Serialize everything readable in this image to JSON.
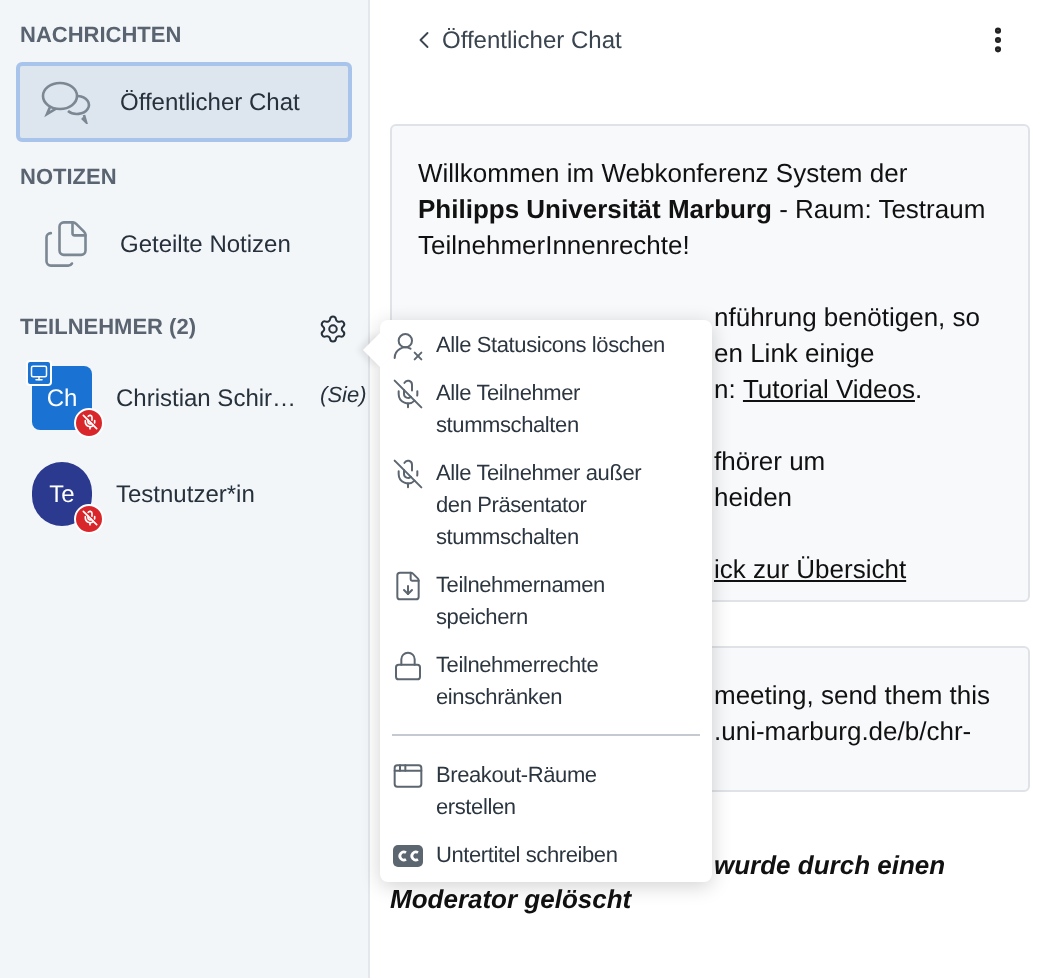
{
  "sidebar": {
    "sections": [
      {
        "title": "NACHRICHTEN",
        "items": [
          {
            "label": "Öffentlicher Chat",
            "selected": true
          }
        ]
      },
      {
        "title": "NOTIZEN",
        "items": [
          {
            "label": "Geteilte Notizen",
            "selected": false
          }
        ]
      }
    ],
    "participants": {
      "title": "TEILNEHMER (2)",
      "users": [
        {
          "initials": "Ch",
          "name": "Christian Schir…",
          "you": "(Sie)",
          "color": "#1a73d3",
          "presenter": true,
          "muted": true
        },
        {
          "initials": "Te",
          "name": "Testnutzer*in",
          "color": "#2b3a8f",
          "presenter": false,
          "muted": true
        }
      ]
    }
  },
  "chat": {
    "title": "Öffentlicher Chat",
    "cards": [
      {
        "paragraphs": [
          {
            "lines": [
              {
                "segments": [
                  {
                    "text": "Willkommen im Webkonferenz System der",
                    "link": false
                  }
                ]
              },
              {
                "segments": [
                  {
                    "text": "**Philipps Universität Marburg** - Raum: Testraum",
                    "link": false
                  }
                ]
              },
              {
                "segments": [
                  {
                    "text": "TeilnehmerInnenrechte!",
                    "link": false
                  }
                ]
              }
            ]
          },
          {
            "lines": [
              {
                "segments": [
                  {
                    "text": "nführung benötigen, so",
                    "link": false
                  }
                ]
              },
              {
                "segments": [
                  {
                    "text": "en Link einige",
                    "link": false
                  }
                ]
              },
              {
                "segments": [
                  {
                    "text": "n: ",
                    "link": false
                  },
                  {
                    "text": "Tutorial Videos",
                    "link": true
                  },
                  {
                    "text": ".",
                    "link": false
                  }
                ]
              }
            ]
          },
          {
            "lines": [
              {
                "segments": [
                  {
                    "text": "fhörer um",
                    "link": false
                  }
                ]
              },
              {
                "segments": [
                  {
                    "text": "heiden",
                    "link": false
                  }
                ]
              }
            ]
          },
          {
            "lines": [
              {
                "segments": [
                  {
                    "text": "ick zur Übersicht",
                    "link": true
                  }
                ]
              }
            ]
          }
        ]
      },
      {
        "paragraphs": [
          {
            "lines": [
              {
                "segments": [
                  {
                    "text": "meeting, send them this",
                    "link": false
                  }
                ]
              },
              {
                "segments": [
                  {
                    "text": ".uni-marburg.de/b/chr-",
                    "link": false
                  }
                ]
              }
            ]
          }
        ]
      }
    ],
    "system_message": {
      "lines": [
        {
          "text": "wurde durch einen"
        },
        {
          "text": "Moderator gelöscht"
        }
      ]
    }
  },
  "menu": {
    "groups": [
      [
        {
          "label": "Alle Statusicons löschen"
        },
        {
          "label": "Alle Teilnehmer stummschalten"
        },
        {
          "label": "Alle Teilnehmer außer den Präsentator stummschalten"
        },
        {
          "label": "Teilnehmernamen speichern"
        },
        {
          "label": "Teilnehmerrechte einschränken"
        }
      ],
      [
        {
          "label": "Breakout-Räume erstellen"
        },
        {
          "label": "Untertitel schreiben"
        }
      ]
    ]
  }
}
